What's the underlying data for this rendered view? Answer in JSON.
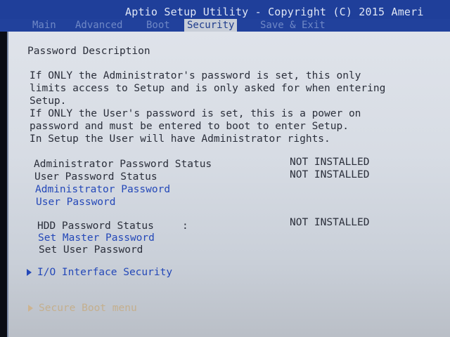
{
  "title": "Aptio Setup Utility - Copyright (C) 2015 Ameri",
  "tabs": [
    {
      "label": "Main"
    },
    {
      "label": "Advanced"
    },
    {
      "label": "Boot"
    },
    {
      "label": "Security"
    },
    {
      "label": "Save & Exit"
    }
  ],
  "section_title": "Password Description",
  "description": [
    "If ONLY the Administrator's password is set, this only",
    "limits access to Setup and is only asked for when entering",
    "Setup.",
    "If ONLY the User's password is set, this is a power on",
    "password and must be entered to boot to enter Setup.",
    "In Setup the User will have Administrator rights."
  ],
  "status_rows": [
    {
      "label": "Administrator Password Status",
      "value": "NOT INSTALLED"
    },
    {
      "label": "User Password Status",
      "value": "NOT INSTALLED"
    }
  ],
  "links": {
    "admin_password": "Administrator Password",
    "user_password": "User Password"
  },
  "hdd": {
    "status_label": "HDD Password Status",
    "colon": ":",
    "status_value": "NOT INSTALLED",
    "set_master": "Set Master Password",
    "set_user": "Set User Password"
  },
  "submenus": {
    "io_interface_security": "I/O Interface Security",
    "secure_boot_menu": "Secure Boot menu"
  },
  "colors": {
    "title_bar": "#1f3f9a",
    "panel": "#dfe3ea",
    "link_blue": "#2448b8",
    "text": "#2a2e3a"
  }
}
